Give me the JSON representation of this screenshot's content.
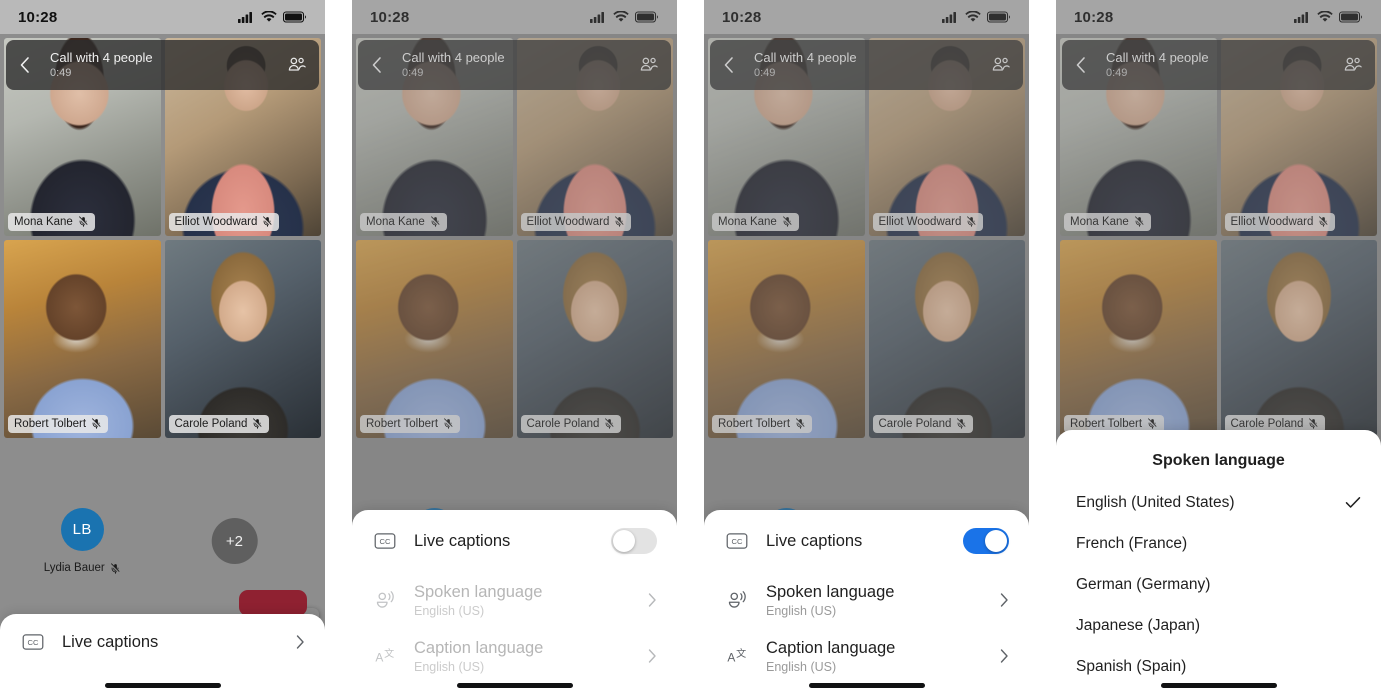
{
  "status_bar": {
    "time": "10:28",
    "icons": [
      "cellular-signal-icon",
      "wifi-icon",
      "battery-icon"
    ]
  },
  "call_header": {
    "back_icon": "chevron-left-icon",
    "title": "Call with 4 people",
    "duration": "0:49",
    "participants_icon": "people-icon"
  },
  "participants": [
    {
      "name": "Mona Kane",
      "muted": true,
      "type": "video"
    },
    {
      "name": "Elliot Woodward",
      "muted": true,
      "type": "video"
    },
    {
      "name": "Robert Tolbert",
      "muted": true,
      "type": "video"
    },
    {
      "name": "Carole Poland",
      "muted": true,
      "type": "video"
    },
    {
      "name": "Lydia Bauer",
      "muted": true,
      "type": "avatar",
      "initials": "LB"
    }
  ],
  "overflow_badge": "+2",
  "self_view": {
    "flip_icon": "camera-flip-icon"
  },
  "panels": [
    {
      "id": "panel-collapsed-sheet",
      "sheet": {
        "type": "collapsed",
        "row": {
          "icon": "cc-icon",
          "title": "Live captions",
          "chevron": "chevron-right-icon"
        }
      }
    },
    {
      "id": "panel-captions-off",
      "sheet": {
        "type": "expanded",
        "toggle_row": {
          "icon": "cc-icon",
          "title": "Live captions",
          "enabled": false
        },
        "rows": [
          {
            "icon": "spoken-language-icon",
            "title": "Spoken language",
            "subtitle": "English (US)",
            "chevron": "chevron-right-icon",
            "disabled": true
          },
          {
            "icon": "caption-language-icon",
            "title": "Caption language",
            "subtitle": "English (US)",
            "chevron": "chevron-right-icon",
            "disabled": true
          }
        ]
      }
    },
    {
      "id": "panel-captions-on",
      "sheet": {
        "type": "expanded",
        "toggle_row": {
          "icon": "cc-icon",
          "title": "Live captions",
          "enabled": true
        },
        "rows": [
          {
            "icon": "spoken-language-icon",
            "title": "Spoken language",
            "subtitle": "English (US)",
            "chevron": "chevron-right-icon",
            "disabled": false
          },
          {
            "icon": "caption-language-icon",
            "title": "Caption language",
            "subtitle": "English (US)",
            "chevron": "chevron-right-icon",
            "disabled": false
          }
        ]
      }
    },
    {
      "id": "panel-language-picker",
      "sheet": {
        "type": "list",
        "title": "Spoken language",
        "options": [
          {
            "label": "English (United States)",
            "selected": true
          },
          {
            "label": "French (France)",
            "selected": false
          },
          {
            "label": "German (Germany)",
            "selected": false
          },
          {
            "label": "Japanese (Japan)",
            "selected": false
          },
          {
            "label": "Spanish (Spain)",
            "selected": false
          }
        ]
      }
    }
  ],
  "colors": {
    "toggle_on": "#1a73e8",
    "toggle_off": "#e3e3e3",
    "avatar": "#1a73b0",
    "end_call": "#8f2131",
    "sheet_bg": "#ffffff",
    "backdrop": "#8d8d8d"
  }
}
